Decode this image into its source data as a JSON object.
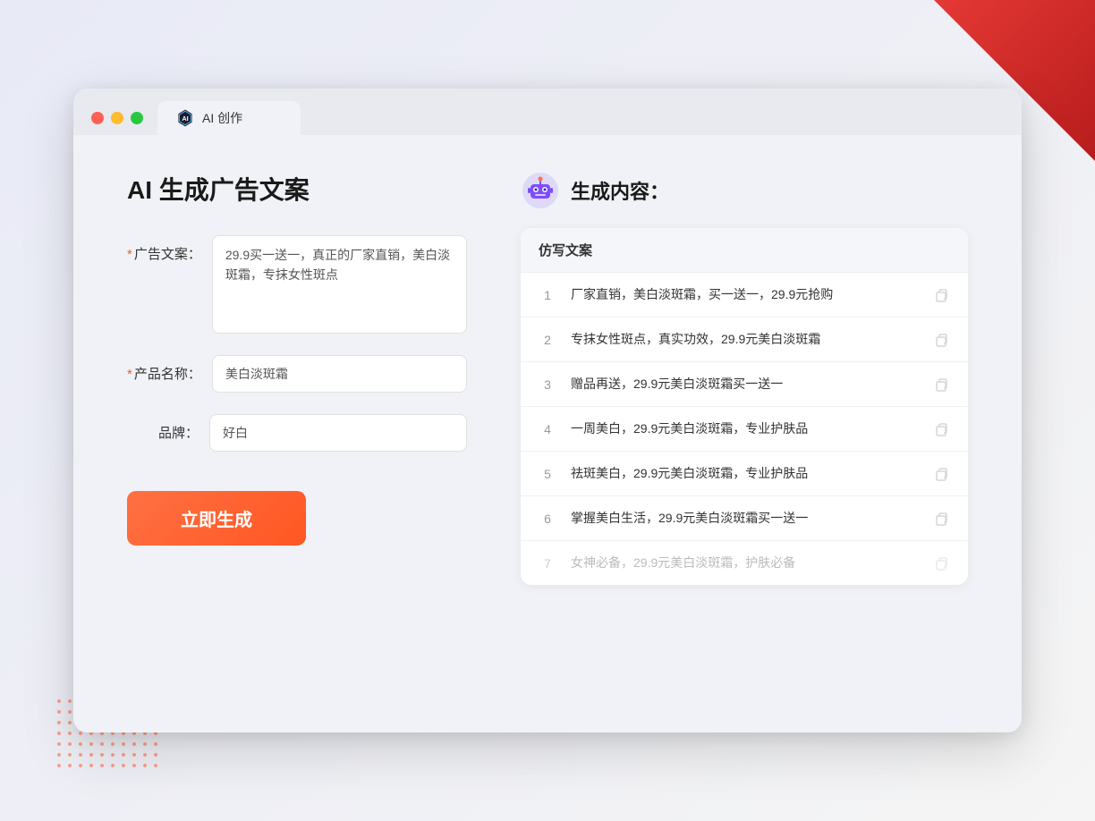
{
  "browser": {
    "tab_title": "AI 创作",
    "traffic_lights": [
      "red",
      "yellow",
      "green"
    ]
  },
  "left_panel": {
    "title": "AI 生成广告文案",
    "form": {
      "ad_copy_label": "广告文案：",
      "ad_copy_required": "＊",
      "ad_copy_value": "29.9买一送一，真正的厂家直销，美白淡斑霜，专抹女性斑点",
      "product_name_label": "产品名称：",
      "product_name_required": "＊",
      "product_name_value": "美白淡斑霜",
      "brand_label": "品牌：",
      "brand_value": "好白"
    },
    "generate_button": "立即生成"
  },
  "right_panel": {
    "title": "生成内容：",
    "table_header": "仿写文案",
    "results": [
      {
        "num": "1",
        "text": "厂家直销，美白淡斑霜，买一送一，29.9元抢购",
        "muted": false
      },
      {
        "num": "2",
        "text": "专抹女性斑点，真实功效，29.9元美白淡斑霜",
        "muted": false
      },
      {
        "num": "3",
        "text": "赠品再送，29.9元美白淡斑霜买一送一",
        "muted": false
      },
      {
        "num": "4",
        "text": "一周美白，29.9元美白淡斑霜，专业护肤品",
        "muted": false
      },
      {
        "num": "5",
        "text": "祛斑美白，29.9元美白淡斑霜，专业护肤品",
        "muted": false
      },
      {
        "num": "6",
        "text": "掌握美白生活，29.9元美白淡斑霜买一送一",
        "muted": false
      },
      {
        "num": "7",
        "text": "女神必备，29.9元美白淡斑霜，护肤必备",
        "muted": true
      }
    ]
  }
}
